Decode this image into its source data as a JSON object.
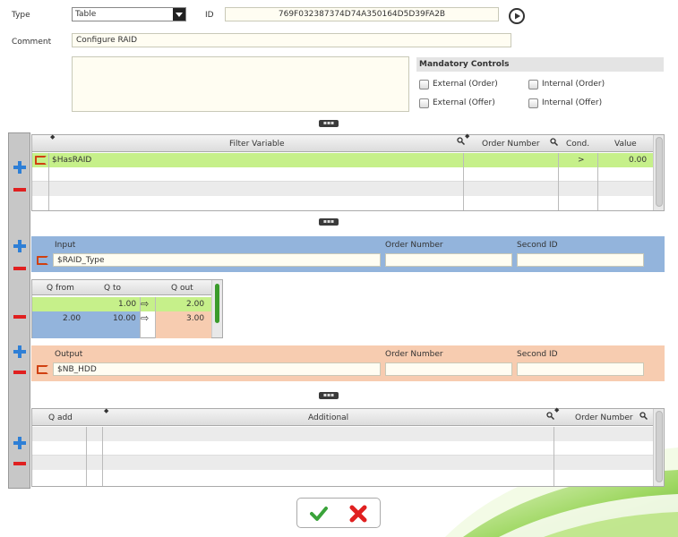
{
  "header": {
    "type_label": "Type",
    "type_value": "Table",
    "id_label": "ID",
    "id_value": "769F032387374D74A350164D5D39FA2B",
    "comment_label": "Comment",
    "comment_value": "Configure RAID"
  },
  "mandatory": {
    "title": "Mandatory Controls",
    "external_order": "External (Order)",
    "internal_order": "Internal (Order)",
    "external_offer": "External (Offer)",
    "internal_offer": "Internal (Offer)"
  },
  "filter_grid": {
    "columns": [
      "Filter Variable",
      "Order Number",
      "Cond.",
      "Value"
    ],
    "rows": [
      {
        "variable": "$HasRAID",
        "order_number": "",
        "cond": ">",
        "value": "0.00"
      }
    ]
  },
  "input_section": {
    "input_label": "Input",
    "input_value": "$RAID_Type",
    "order_number_label": "Order Number",
    "second_id_label": "Second ID"
  },
  "q_table": {
    "columns": [
      "Q from",
      "Q to",
      "Q out"
    ],
    "rows": [
      {
        "from": "",
        "to": "1.00",
        "out": "2.00"
      },
      {
        "from": "2.00",
        "to": "10.00",
        "out": "3.00"
      }
    ]
  },
  "output_section": {
    "output_label": "Output",
    "output_value": "$NB_HDD",
    "order_number_label": "Order Number",
    "second_id_label": "Second ID"
  },
  "additional_grid": {
    "columns": [
      "Q add",
      "Additional",
      "Order Number"
    ]
  },
  "colors": {
    "green_row": "#c6f08a",
    "blue_section": "#93b4dc",
    "peach_section": "#f7ccb0",
    "plus": "#2e7fd6",
    "minus": "#e02020"
  }
}
